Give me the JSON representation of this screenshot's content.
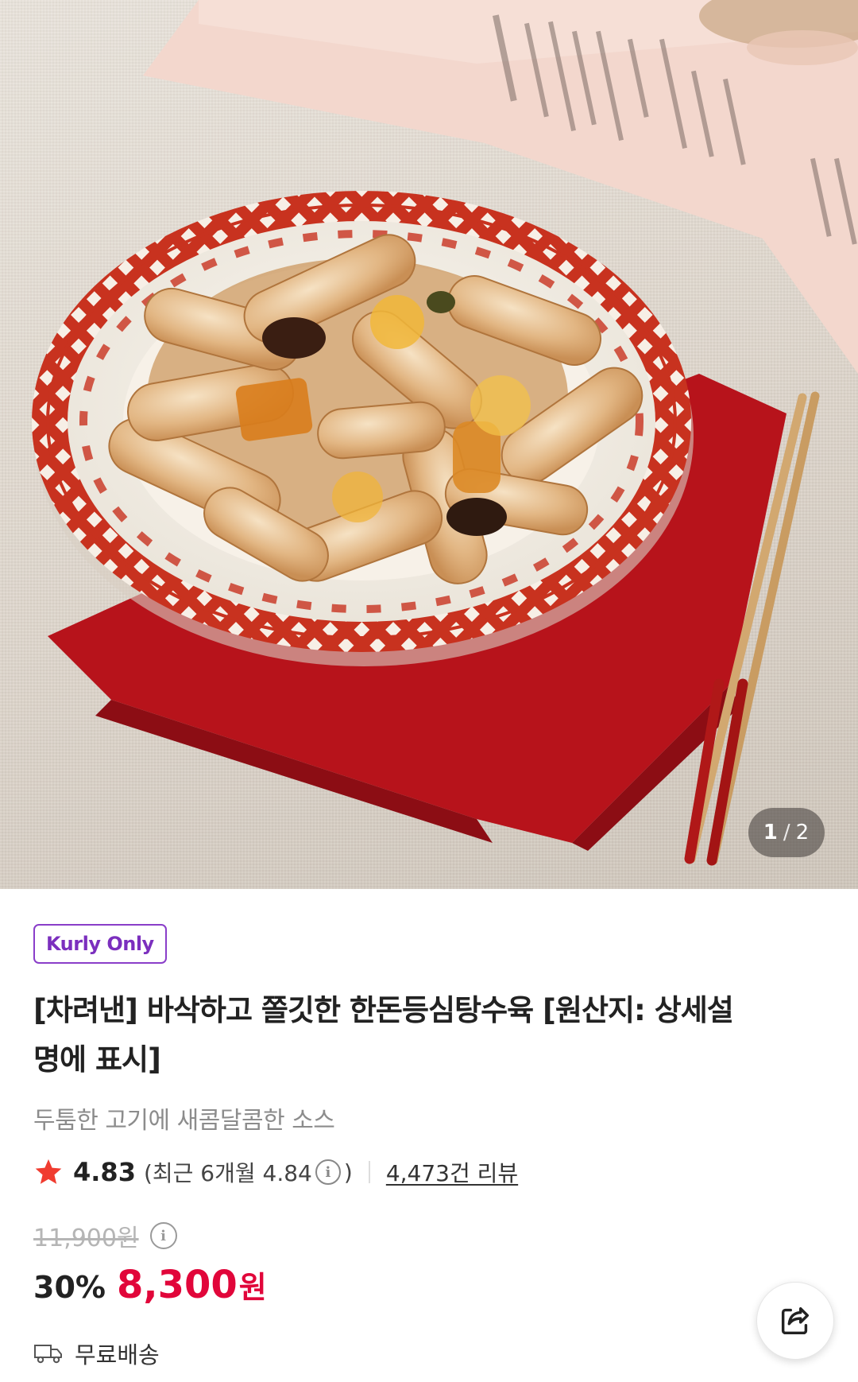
{
  "gallery": {
    "current_page": "1",
    "separator": "/",
    "total_pages": "2",
    "image_subject": "sweet-and-sour-pork-plate"
  },
  "product": {
    "badge": "Kurly Only",
    "title": "[차려낸] 바삭하고 쫄깃한 한돈등심탕수육 [원산지: 상세설명에 표시]",
    "subtitle": "두툼한 고기에 새콤달콤한 소스",
    "rating": "4.83",
    "rating_recent_prefix": "(최근 6개월 4.84",
    "rating_recent_suffix": ")",
    "review_count": "4,473건 리뷰",
    "original_price": "11,900원",
    "discount_rate": "30%",
    "sale_price": "8,300",
    "sale_price_unit": "원",
    "delivery": "무료배송"
  },
  "icons": {
    "star": "star-icon",
    "info": "info-icon",
    "share": "share-icon",
    "delivery": "truck-icon"
  },
  "colors": {
    "accent_purple": "#7b2fbe",
    "sale_red": "#e1063a",
    "star_red": "#f03c30",
    "muted_gray": "#8c8c8c"
  }
}
